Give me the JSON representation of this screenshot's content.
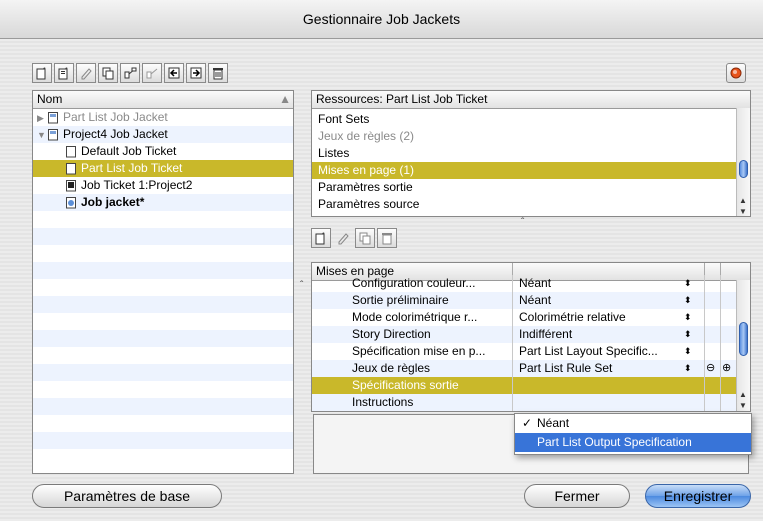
{
  "window": {
    "title": "Gestionnaire Job Jackets"
  },
  "left_panel": {
    "header": "Nom",
    "items": [
      {
        "label": "Part List Job Jacket",
        "style": "gray",
        "icon": "jacket-icon",
        "indent": 0,
        "disclosure": "closed"
      },
      {
        "label": "Project4 Job Jacket",
        "style": "normal",
        "icon": "jacket-icon",
        "indent": 0,
        "disclosure": "open"
      },
      {
        "label": "Default Job Ticket",
        "style": "normal",
        "icon": "ticket-icon",
        "indent": 2
      },
      {
        "label": "Part List Job Ticket",
        "style": "selected",
        "icon": "ticket-icon",
        "indent": 2
      },
      {
        "label": "Job Ticket 1:Project2",
        "style": "normal",
        "icon": "linked-ticket-icon",
        "indent": 2
      },
      {
        "label": "Job jacket*",
        "style": "bold",
        "icon": "project-icon",
        "indent": 2
      }
    ]
  },
  "resources_panel": {
    "header": "Ressources: Part List Job Ticket",
    "items": [
      {
        "label": "Font Sets",
        "style": "normal"
      },
      {
        "label": "Jeux de règles (2)",
        "style": "gray"
      },
      {
        "label": "Listes",
        "style": "normal"
      },
      {
        "label": "Mises en page (1)",
        "style": "selected"
      },
      {
        "label": "Paramètres sortie",
        "style": "normal"
      },
      {
        "label": "Paramètres source",
        "style": "normal"
      }
    ]
  },
  "properties_panel": {
    "header": "Mises en page",
    "rows": [
      {
        "label": "Configuration couleur...",
        "value": "Néant"
      },
      {
        "label": "Sortie préliminaire",
        "value": "Néant"
      },
      {
        "label": "Mode colorimétrique r...",
        "value": "Colorimétrie relative"
      },
      {
        "label": "Story Direction",
        "value": "Indifférent"
      },
      {
        "label": "Spécification mise en p...",
        "value": "Part List Layout Specific..."
      },
      {
        "label": "Jeux de règles",
        "value": "Part List Rule Set"
      },
      {
        "label": "Spécifications sortie",
        "value": ""
      },
      {
        "label": "Instructions",
        "value": ""
      }
    ]
  },
  "popup_menu": {
    "options": [
      {
        "label": "Néant",
        "checked": true
      },
      {
        "label": "Part List Output Specification",
        "highlighted": true
      }
    ]
  },
  "buttons": {
    "base_settings": "Paramètres de base",
    "close": "Fermer",
    "save": "Enregistrer"
  },
  "colors": {
    "selection": "#c9b82a",
    "accent_blue": "#3874d8",
    "stripe": "#edf3fe"
  }
}
